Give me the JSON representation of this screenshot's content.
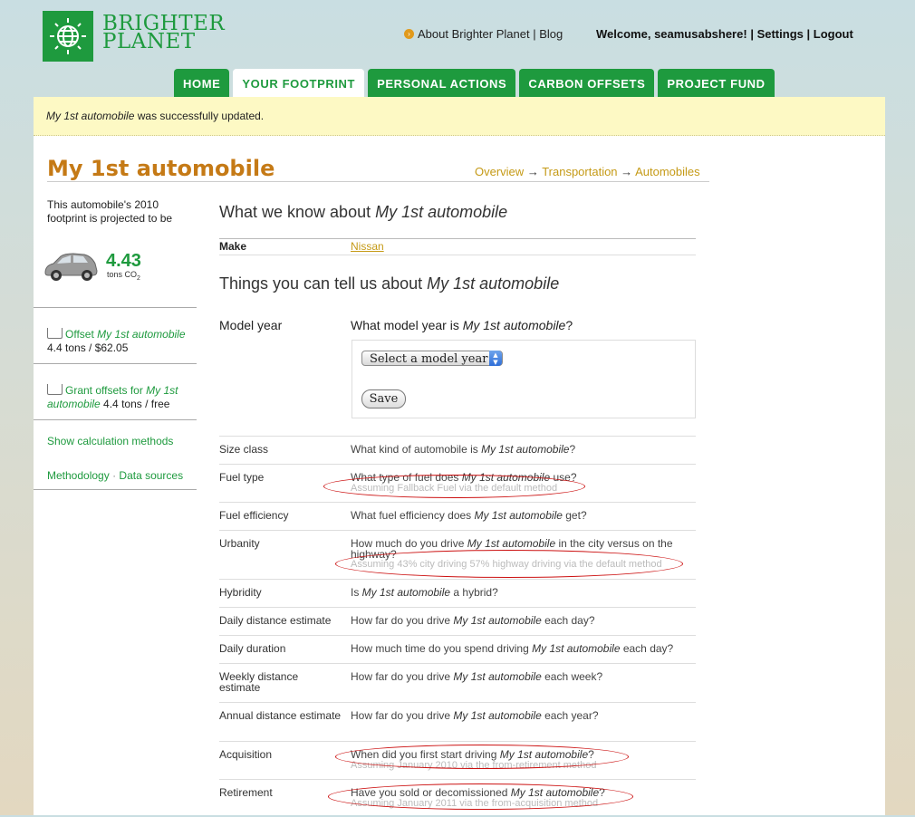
{
  "brand": {
    "line1": "BRIGHTER",
    "line2": "PLANET"
  },
  "toplinks": {
    "about": "About Brighter Planet",
    "sep": "|",
    "blog": "Blog"
  },
  "user": {
    "welcome_prefix": "Welcome, ",
    "username": "seamusabshere!",
    "settings": "Settings",
    "logout": "Logout",
    "sep": "|"
  },
  "nav": {
    "tabs": [
      "HOME",
      "YOUR FOOTPRINT",
      "PERSONAL ACTIONS",
      "CARBON OFFSETS",
      "PROJECT FUND"
    ],
    "active": "YOUR FOOTPRINT"
  },
  "flash": {
    "name": "My 1st automobile",
    "rest": " was successfully updated."
  },
  "page": {
    "title": "My 1st automobile"
  },
  "breadcrumb": {
    "overview": "Overview",
    "arrow": "→",
    "transportation": "Transportation",
    "automobiles": "Automobiles"
  },
  "sidebar": {
    "projected": "This automobile's 2010 footprint is projected to be",
    "value": "4.43",
    "unit_prefix": "tons CO",
    "unit_sub": "2",
    "offset": {
      "prefix": "Offset ",
      "name": "My 1st automobile",
      "detail": "4.4 tons / $62.05"
    },
    "grant": {
      "prefix": "Grant offsets for ",
      "name": "My 1st automobile",
      "detail": " 4.4 tons / free"
    },
    "show_methods": "Show calculation methods",
    "methodology": "Methodology",
    "dot": "·",
    "data_sources": "Data sources"
  },
  "main": {
    "know_prefix": "What we know about ",
    "know_name": "My 1st automobile",
    "make_label": "Make",
    "make_value": "Nissan",
    "tell_prefix": "Things you can tell us about ",
    "tell_name": "My 1st automobile",
    "model_year_label": "Model year",
    "model_year_q_prefix": "What model year is ",
    "model_year_q_name": "My 1st automobile",
    "model_year_q_suffix": "?",
    "select_value": "Select a model year",
    "save_label": "Save"
  },
  "rows": [
    {
      "label": "Size class",
      "q_pre": "What kind of automobile is ",
      "q_name": "My 1st automobile",
      "q_post": "?",
      "sub": ""
    },
    {
      "label": "Fuel type",
      "q_pre": "What type of fuel does ",
      "q_name": "My 1st automobile",
      "q_post": " use?",
      "sub": "Assuming Fallback Fuel via the default method"
    },
    {
      "label": "Fuel efficiency",
      "q_pre": "What fuel efficiency does ",
      "q_name": "My 1st automobile",
      "q_post": " get?",
      "sub": ""
    },
    {
      "label": "Urbanity",
      "q_pre": "How much do you drive ",
      "q_name": "My 1st automobile",
      "q_post": " in the city versus on the highway?",
      "sub": "Assuming 43% city driving 57% highway driving via the default method"
    },
    {
      "label": "Hybridity",
      "q_pre": "Is ",
      "q_name": "My 1st automobile",
      "q_post": " a hybrid?",
      "sub": ""
    },
    {
      "label": "Daily distance estimate",
      "q_pre": "How far do you drive ",
      "q_name": "My 1st automobile",
      "q_post": " each day?",
      "sub": ""
    },
    {
      "label": "Daily duration",
      "q_pre": "How much time do you spend driving ",
      "q_name": "My 1st automobile",
      "q_post": " each day?",
      "sub": ""
    },
    {
      "label": "Weekly distance estimate",
      "q_pre": "How far do you drive ",
      "q_name": "My 1st automobile",
      "q_post": " each week?",
      "sub": ""
    },
    {
      "label": "Annual distance estimate",
      "q_pre": "How far do you drive ",
      "q_name": "My 1st automobile",
      "q_post": " each year?",
      "sub": ""
    },
    {
      "label": "Acquisition",
      "q_pre": "When did you first start driving ",
      "q_name": "My 1st automobile",
      "q_post": "?",
      "sub": "Assuming January 2010 via the from-retirement method"
    },
    {
      "label": "Retirement",
      "q_pre": "Have you sold or decomissioned ",
      "q_name": "My 1st automobile",
      "q_post": "?",
      "sub": "Assuming January 2011 via the from-acquisition method"
    }
  ],
  "colors": {
    "brand_green": "#1e9a3e",
    "title_orange": "#c57a16",
    "link_gold": "#c59a16",
    "flash_bg": "#fdf9c4",
    "annotation_red": "#cc1111"
  }
}
